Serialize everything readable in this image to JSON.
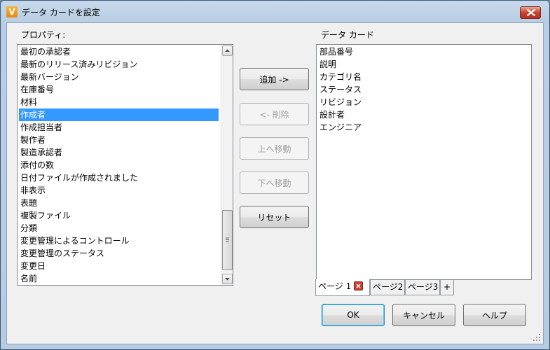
{
  "window": {
    "title": "データ カードを設定",
    "app_icon_letter": "V"
  },
  "left": {
    "label": "プロパティ:",
    "items": [
      "最初の承認者",
      "最新のリリース済みリビジョン",
      "最新バージョン",
      "在庫番号",
      "材料",
      "作成者",
      "作成担当者",
      "製作者",
      "製造承認者",
      "添付の数",
      "日付ファイルが作成されました",
      "非表示",
      "表題",
      "複製ファイル",
      "分類",
      "変更管理によるコントロール",
      "変更管理のステータス",
      "変更日",
      "名前"
    ],
    "selected_index": 5,
    "scroll_position": 0.92
  },
  "middle": {
    "add_label": "追加 ->",
    "remove_label": "<- 削除",
    "move_up_label": "上へ移動",
    "move_down_label": "下へ移動",
    "reset_label": "リセット"
  },
  "right": {
    "label": "データ カード",
    "items": [
      "部品番号",
      "説明",
      "カテゴリ名",
      "ステータス",
      "リビジョン",
      "設計者",
      "エンジニア"
    ],
    "tabs": [
      "ページ 1",
      "ページ2",
      "ページ3",
      "+"
    ]
  },
  "footer": {
    "ok_label": "OK",
    "cancel_label": "キャンセル",
    "help_label": "ヘルプ"
  },
  "colors": {
    "selection": "#3399ff",
    "title_gradient_top": "#c7d8ea",
    "close_button": "#c7432f",
    "app_icon": "#f0a020"
  }
}
